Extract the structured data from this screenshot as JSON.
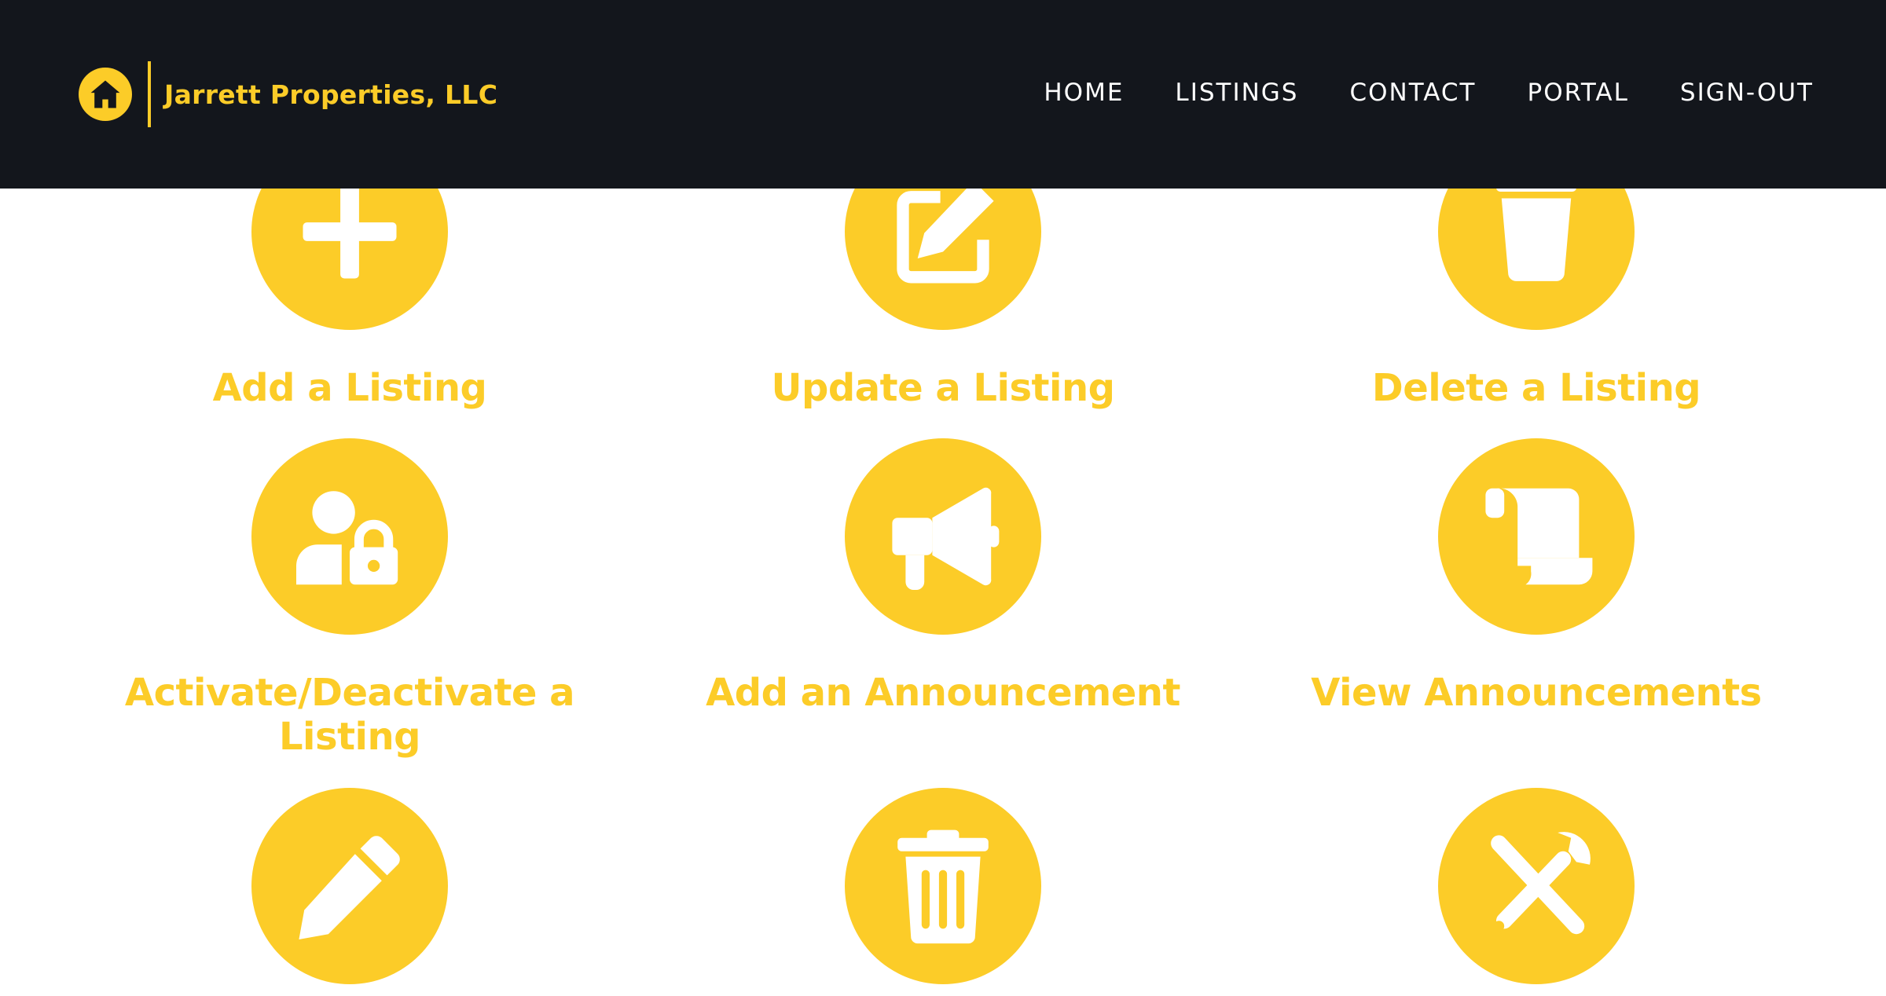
{
  "colors": {
    "header_bg": "#13161c",
    "accent": "#fccc28",
    "nav_text": "#ffffff",
    "page_bg": "#ffffff",
    "icon_fg": "#ffffff"
  },
  "brand": {
    "name": "Jarrett Properties, LLC",
    "logo_icon": "home-icon"
  },
  "nav": {
    "items": [
      {
        "label": "HOME"
      },
      {
        "label": "LISTINGS"
      },
      {
        "label": "CONTACT"
      },
      {
        "label": "PORTAL"
      },
      {
        "label": "SIGN-OUT"
      }
    ]
  },
  "tiles": [
    {
      "label": "Add a Listing",
      "icon": "plus-icon"
    },
    {
      "label": "Update a Listing",
      "icon": "edit-square-icon"
    },
    {
      "label": "Delete a Listing",
      "icon": "bucket-icon"
    },
    {
      "label": "Activate/Deactivate a Listing",
      "icon": "user-lock-icon"
    },
    {
      "label": "Add an Announcement",
      "icon": "megaphone-icon"
    },
    {
      "label": "View Announcements",
      "icon": "scroll-icon"
    },
    {
      "label": "",
      "icon": "pencil-icon"
    },
    {
      "label": "",
      "icon": "trash-icon"
    },
    {
      "label": "",
      "icon": "screwdriver-wrench-icon"
    }
  ]
}
